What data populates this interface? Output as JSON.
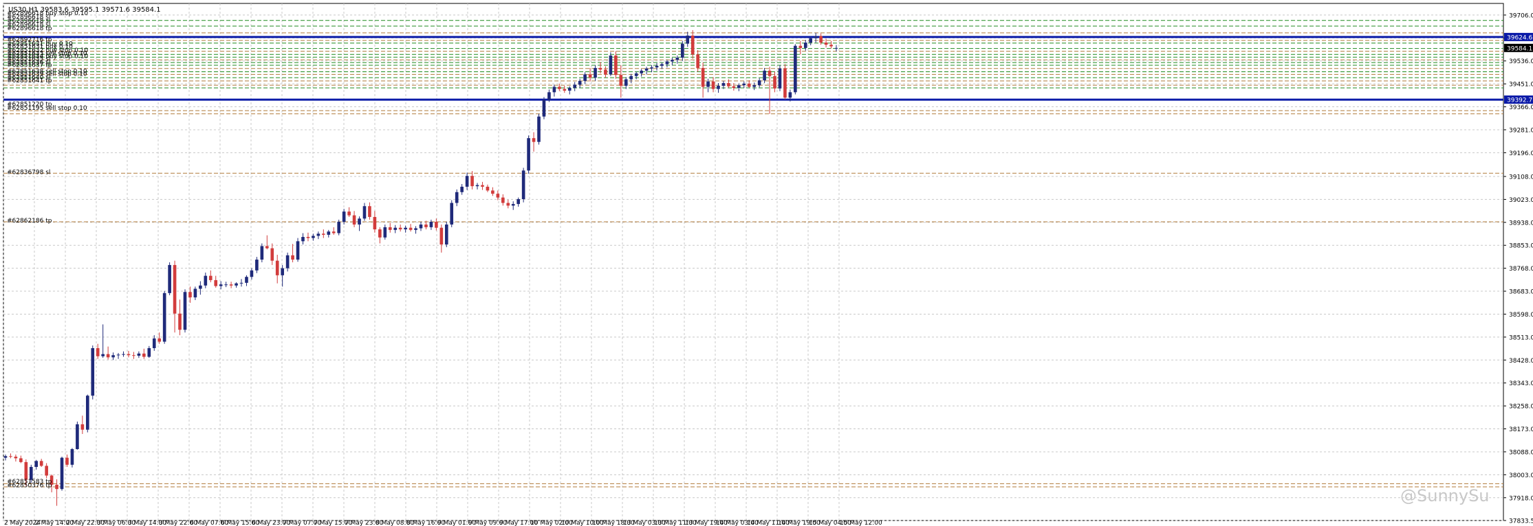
{
  "chart_data": {
    "type": "candlestick",
    "title": "US30,H1  39583.6 39595.1 39571.6 39584.1",
    "symbol": "US30",
    "timeframe": "H1",
    "ohlc_header": [
      "39583.6",
      "39595.1",
      "39571.6",
      "39584.1"
    ],
    "ylim": [
      37833.5,
      39749
    ],
    "grid": true,
    "colors": {
      "up": "#1f2a7a",
      "down": "#d23c3c",
      "grid": "#c8c8c8",
      "hline_blue": "#0a1aa8",
      "level_green": "#1f8a1f",
      "level_tan": "#b07a3a"
    },
    "y_ticks": [
      "39706.0",
      "39621.0",
      "39536.0",
      "39451.0",
      "39366.0",
      "39281.0",
      "39196.0",
      "39108.0",
      "39023.0",
      "38938.0",
      "38853.0",
      "38768.0",
      "38683.0",
      "38598.0",
      "38513.0",
      "38428.0",
      "38343.0",
      "38258.0",
      "38173.0",
      "38088.0",
      "38003.0",
      "37918.0",
      "37833.5"
    ],
    "y_tick_values": [
      39706,
      39621,
      39536,
      39451,
      39366,
      39281,
      39196,
      39108,
      39023,
      38938,
      38853,
      38768,
      38683,
      38598,
      38513,
      38428,
      38343,
      38258,
      38173,
      38088,
      38003,
      37918,
      37833.5
    ],
    "x_ticks": [
      "2 May 2024",
      "2 May 14:00",
      "2 May 22:00",
      "3 May 06:00",
      "3 May 14:00",
      "3 May 22:00",
      "6 May 07:00",
      "6 May 15:00",
      "6 May 23:00",
      "7 May 07:00",
      "7 May 15:00",
      "7 May 23:00",
      "8 May 08:00",
      "8 May 16:00",
      "9 May 01:00",
      "9 May 09:00",
      "9 May 17:00",
      "10 May 02:00",
      "10 May 10:00",
      "10 May 18:00",
      "13 May 03:00",
      "13 May 11:00",
      "13 May 19:00",
      "14 May 03:00",
      "14 May 11:00",
      "14 May 19:00",
      "15 May 04:00",
      "15 May 12:00"
    ],
    "price_tags": [
      {
        "text": "39624.6",
        "value": 39624.6,
        "color": "#0a1aa8"
      },
      {
        "text": "39584.1",
        "value": 39584.1,
        "color": "#000000"
      },
      {
        "text": "39392.7",
        "value": 39392.7,
        "color": "#0a1aa8"
      }
    ],
    "blue_lines": [
      39624.6,
      39392.7
    ],
    "levels": [
      {
        "value": 39686,
        "color": "green"
      },
      {
        "value": 39665,
        "color": "green"
      },
      {
        "value": 39640,
        "color": "tan"
      },
      {
        "value": 39612,
        "color": "tan"
      },
      {
        "value": 39602,
        "color": "green"
      },
      {
        "value": 39582,
        "color": "green"
      },
      {
        "value": 39572,
        "color": "tan"
      },
      {
        "value": 39560,
        "color": "green"
      },
      {
        "value": 39550,
        "color": "green"
      },
      {
        "value": 39540,
        "color": "tan"
      },
      {
        "value": 39530,
        "color": "green"
      },
      {
        "value": 39520,
        "color": "green"
      },
      {
        "value": 39508,
        "color": "tan"
      },
      {
        "value": 39496,
        "color": "green"
      },
      {
        "value": 39486,
        "color": "tan"
      },
      {
        "value": 39474,
        "color": "green"
      },
      {
        "value": 39462,
        "color": "tan"
      },
      {
        "value": 39446,
        "color": "tan"
      },
      {
        "value": 39436,
        "color": "green"
      },
      {
        "value": 39352,
        "color": "tan"
      },
      {
        "value": 39340,
        "color": "tan"
      },
      {
        "value": 39120,
        "color": "tan"
      },
      {
        "value": 38940,
        "color": "tan"
      },
      {
        "value": 37970,
        "color": "tan"
      },
      {
        "value": 37958,
        "color": "tan"
      }
    ],
    "order_labels": [
      {
        "text": "#62896618 buy stop 0.10",
        "value": 39714
      },
      {
        "text": "#62896618 sl",
        "value": 39700
      },
      {
        "text": "#62896618 sl",
        "value": 39686
      },
      {
        "text": "#62896618 sl",
        "value": 39672
      },
      {
        "text": "#62896618 tp",
        "value": 39658
      },
      {
        "text": "#62892716 tp",
        "value": 39616
      },
      {
        "text": "#62851631 buy 0.10",
        "value": 39600
      },
      {
        "text": "#62851631 buy 0.10",
        "value": 39590
      },
      {
        "text": "#62851632 buy stop 0.10",
        "value": 39576
      },
      {
        "text": "#62851633 sell stop 0.10",
        "value": 39565
      },
      {
        "text": "#62851634 buy stop 0.10",
        "value": 39554
      },
      {
        "text": "#62851635 sl",
        "value": 39544
      },
      {
        "text": "#62851636 sl",
        "value": 39532
      },
      {
        "text": "#62851637 tp",
        "value": 39521
      },
      {
        "text": "#62851638 sell stop 0.10",
        "value": 39499
      },
      {
        "text": "#62851639 sell stop 0.10",
        "value": 39488
      },
      {
        "text": "#62851640 sl",
        "value": 39476
      },
      {
        "text": "#62851641 tp",
        "value": 39464
      },
      {
        "text": "#62851220 tp",
        "value": 39376
      },
      {
        "text": "#62851195 sell stop 0.10",
        "value": 39362
      },
      {
        "text": "#62836798 sl",
        "value": 39125
      },
      {
        "text": "#62862186 tp",
        "value": 38945
      },
      {
        "text": "#62851583 tp",
        "value": 37978
      },
      {
        "text": "#62850376 tp",
        "value": 37964
      }
    ],
    "candles": [
      [
        38066,
        38078,
        38056,
        38072
      ],
      [
        38072,
        38082,
        38064,
        38070
      ],
      [
        38070,
        38078,
        38052,
        38064
      ],
      [
        38064,
        38074,
        38046,
        38050
      ],
      [
        38050,
        38060,
        37962,
        37984
      ],
      [
        37984,
        38040,
        37974,
        38032
      ],
      [
        38032,
        38058,
        38022,
        38054
      ],
      [
        38054,
        38062,
        38032,
        38036
      ],
      [
        38036,
        38046,
        37990,
        38000
      ],
      [
        38000,
        38004,
        37938,
        37966
      ],
      [
        37966,
        37986,
        37888,
        37950
      ],
      [
        37950,
        38070,
        37944,
        38066
      ],
      [
        38066,
        38078,
        38032,
        38040
      ],
      [
        38040,
        38102,
        38030,
        38098
      ],
      [
        38098,
        38200,
        38096,
        38190
      ],
      [
        38190,
        38222,
        38154,
        38170
      ],
      [
        38170,
        38300,
        38160,
        38296
      ],
      [
        38296,
        38482,
        38282,
        38472
      ],
      [
        38472,
        38488,
        38432,
        38442
      ],
      [
        38442,
        38560,
        38436,
        38450
      ],
      [
        38450,
        38478,
        38430,
        38438
      ],
      [
        38438,
        38456,
        38428,
        38446
      ],
      [
        38446,
        38454,
        38432,
        38448
      ],
      [
        38448,
        38460,
        38440,
        38450
      ],
      [
        38450,
        38462,
        38438,
        38446
      ],
      [
        38446,
        38458,
        38432,
        38444
      ],
      [
        38444,
        38460,
        38436,
        38452
      ],
      [
        38452,
        38470,
        38432,
        38440
      ],
      [
        38440,
        38480,
        38436,
        38472
      ],
      [
        38472,
        38520,
        38462,
        38508
      ],
      [
        38508,
        38530,
        38488,
        38496
      ],
      [
        38496,
        38684,
        38488,
        38676
      ],
      [
        38676,
        38790,
        38668,
        38780
      ],
      [
        38780,
        38796,
        38530,
        38600
      ],
      [
        38600,
        38652,
        38520,
        38540
      ],
      [
        38540,
        38690,
        38530,
        38680
      ],
      [
        38680,
        38700,
        38640,
        38660
      ],
      [
        38660,
        38700,
        38650,
        38692
      ],
      [
        38692,
        38720,
        38670,
        38704
      ],
      [
        38704,
        38752,
        38694,
        38740
      ],
      [
        38740,
        38760,
        38716,
        38724
      ],
      [
        38724,
        38740,
        38696,
        38702
      ],
      [
        38702,
        38720,
        38690,
        38708
      ],
      [
        38708,
        38718,
        38698,
        38708
      ],
      [
        38708,
        38718,
        38694,
        38704
      ],
      [
        38704,
        38716,
        38696,
        38712
      ],
      [
        38712,
        38728,
        38700,
        38714
      ],
      [
        38714,
        38742,
        38702,
        38736
      ],
      [
        38736,
        38768,
        38726,
        38760
      ],
      [
        38760,
        38810,
        38750,
        38800
      ],
      [
        38800,
        38860,
        38790,
        38850
      ],
      [
        38850,
        38890,
        38838,
        38842
      ],
      [
        38842,
        38860,
        38780,
        38796
      ],
      [
        38796,
        38818,
        38712,
        38742
      ],
      [
        38742,
        38780,
        38700,
        38768
      ],
      [
        38768,
        38826,
        38756,
        38816
      ],
      [
        38816,
        38858,
        38790,
        38800
      ],
      [
        38800,
        38880,
        38792,
        38868
      ],
      [
        38868,
        38898,
        38856,
        38884
      ],
      [
        38884,
        38900,
        38868,
        38880
      ],
      [
        38880,
        38896,
        38870,
        38888
      ],
      [
        38888,
        38904,
        38876,
        38896
      ],
      [
        38896,
        38912,
        38880,
        38892
      ],
      [
        38892,
        38910,
        38882,
        38904
      ],
      [
        38904,
        38920,
        38892,
        38898
      ],
      [
        38898,
        38948,
        38890,
        38940
      ],
      [
        38940,
        38988,
        38930,
        38978
      ],
      [
        38978,
        38994,
        38958,
        38964
      ],
      [
        38964,
        38980,
        38920,
        38930
      ],
      [
        38930,
        38960,
        38906,
        38952
      ],
      [
        38952,
        39010,
        38944,
        38998
      ],
      [
        38998,
        39012,
        38948,
        38958
      ],
      [
        38958,
        38980,
        38900,
        38912
      ],
      [
        38912,
        38920,
        38860,
        38882
      ],
      [
        38882,
        38930,
        38874,
        38920
      ],
      [
        38920,
        38936,
        38900,
        38910
      ],
      [
        38910,
        38928,
        38898,
        38918
      ],
      [
        38918,
        38930,
        38904,
        38912
      ],
      [
        38912,
        38926,
        38900,
        38918
      ],
      [
        38918,
        38932,
        38904,
        38910
      ],
      [
        38910,
        38924,
        38896,
        38916
      ],
      [
        38916,
        38940,
        38906,
        38930
      ],
      [
        38930,
        38944,
        38912,
        38920
      ],
      [
        38920,
        38948,
        38910,
        38940
      ],
      [
        38940,
        38952,
        38908,
        38918
      ],
      [
        38918,
        38930,
        38826,
        38856
      ],
      [
        38856,
        38940,
        38846,
        38930
      ],
      [
        38930,
        39020,
        38920,
        39010
      ],
      [
        39010,
        39060,
        38998,
        39050
      ],
      [
        39050,
        39080,
        39040,
        39070
      ],
      [
        39070,
        39122,
        39058,
        39110
      ],
      [
        39110,
        39128,
        39060,
        39072
      ],
      [
        39072,
        39084,
        39060,
        39076
      ],
      [
        39076,
        39088,
        39058,
        39070
      ],
      [
        39070,
        39078,
        39050,
        39056
      ],
      [
        39056,
        39068,
        39036,
        39044
      ],
      [
        39044,
        39056,
        39020,
        39030
      ],
      [
        39030,
        39042,
        39000,
        39010
      ],
      [
        39010,
        39022,
        38990,
        39000
      ],
      [
        39000,
        39016,
        38984,
        39006
      ],
      [
        39006,
        39030,
        38996,
        39024
      ],
      [
        39024,
        39140,
        39012,
        39130
      ],
      [
        39130,
        39260,
        39118,
        39250
      ],
      [
        39250,
        39272,
        39200,
        39236
      ],
      [
        39236,
        39340,
        39226,
        39330
      ],
      [
        39330,
        39402,
        39320,
        39392
      ],
      [
        39392,
        39430,
        39384,
        39420
      ],
      [
        39420,
        39448,
        39404,
        39440
      ],
      [
        39440,
        39452,
        39424,
        39432
      ],
      [
        39432,
        39444,
        39418,
        39426
      ],
      [
        39426,
        39442,
        39412,
        39436
      ],
      [
        39436,
        39458,
        39424,
        39448
      ],
      [
        39448,
        39470,
        39436,
        39462
      ],
      [
        39462,
        39494,
        39450,
        39486
      ],
      [
        39486,
        39510,
        39460,
        39474
      ],
      [
        39474,
        39520,
        39462,
        39510
      ],
      [
        39510,
        39532,
        39490,
        39504
      ],
      [
        39504,
        39516,
        39474,
        39486
      ],
      [
        39486,
        39568,
        39480,
        39556
      ],
      [
        39556,
        39572,
        39470,
        39484
      ],
      [
        39484,
        39520,
        39400,
        39444
      ],
      [
        39444,
        39476,
        39432,
        39468
      ],
      [
        39468,
        39488,
        39454,
        39480
      ],
      [
        39480,
        39496,
        39468,
        39490
      ],
      [
        39490,
        39506,
        39478,
        39500
      ],
      [
        39500,
        39514,
        39486,
        39508
      ],
      [
        39508,
        39520,
        39494,
        39512
      ],
      [
        39512,
        39528,
        39500,
        39518
      ],
      [
        39518,
        39530,
        39506,
        39524
      ],
      [
        39524,
        39540,
        39512,
        39534
      ],
      [
        39534,
        39548,
        39520,
        39540
      ],
      [
        39540,
        39556,
        39526,
        39548
      ],
      [
        39548,
        39610,
        39536,
        39600
      ],
      [
        39600,
        39644,
        39588,
        39630
      ],
      [
        39630,
        39650,
        39544,
        39560
      ],
      [
        39560,
        39576,
        39496,
        39510
      ],
      [
        39510,
        39530,
        39400,
        39440
      ],
      [
        39440,
        39470,
        39420,
        39460
      ],
      [
        39460,
        39476,
        39420,
        39432
      ],
      [
        39432,
        39454,
        39418,
        39444
      ],
      [
        39444,
        39462,
        39432,
        39454
      ],
      [
        39454,
        39468,
        39436,
        39442
      ],
      [
        39442,
        39454,
        39426,
        39436
      ],
      [
        39436,
        39452,
        39424,
        39446
      ],
      [
        39446,
        39460,
        39436,
        39452
      ],
      [
        39452,
        39464,
        39436,
        39440
      ],
      [
        39440,
        39456,
        39428,
        39446
      ],
      [
        39446,
        39472,
        39438,
        39464
      ],
      [
        39464,
        39510,
        39454,
        39500
      ],
      [
        39500,
        39514,
        39340,
        39480
      ],
      [
        39480,
        39496,
        39420,
        39434
      ],
      [
        39434,
        39520,
        39424,
        39508
      ],
      [
        39508,
        39524,
        39394,
        39400
      ],
      [
        39400,
        39430,
        39386,
        39420
      ],
      [
        39420,
        39598,
        39412,
        39592
      ],
      [
        39592,
        39610,
        39560,
        39584
      ],
      [
        39584,
        39614,
        39574,
        39604
      ],
      [
        39604,
        39626,
        39594,
        39620
      ],
      [
        39620,
        39640,
        39604,
        39628
      ],
      [
        39628,
        39638,
        39596,
        39604
      ],
      [
        39604,
        39618,
        39586,
        39596
      ],
      [
        39596,
        39610,
        39582,
        39590
      ],
      [
        39583.6,
        39595.1,
        39571.6,
        39584.1
      ]
    ]
  },
  "watermark": {
    "text": "@SunnySu"
  }
}
